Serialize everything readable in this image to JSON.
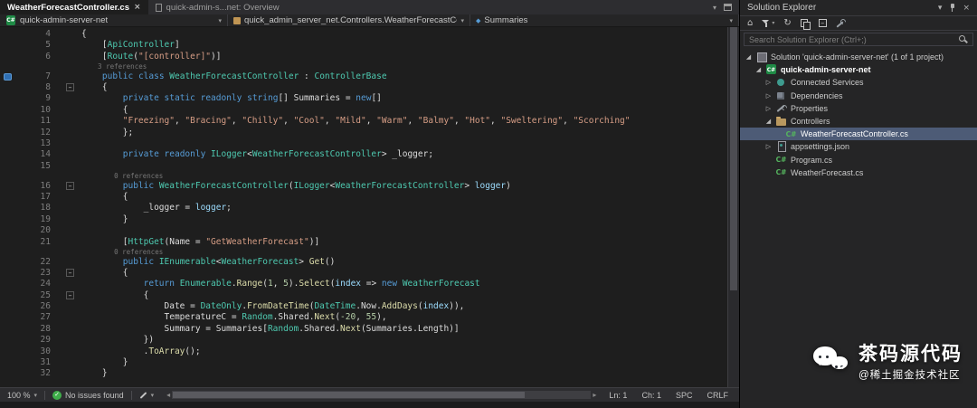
{
  "colors": {
    "accent_blue": "#569cd6",
    "type_teal": "#4ec9b0",
    "string_orange": "#d69d85",
    "status_green": "#3fae4a",
    "selection": "#4d5b76"
  },
  "icons": {
    "close": "×",
    "chevron_down": "▾",
    "check": "✓",
    "home": "⌂",
    "sync": "↻",
    "scroll_left": "◂",
    "scroll_right": "▸",
    "tree_expanded": "◢",
    "tree_collapsed": "▷",
    "csharp": "C#",
    "fold_minus": "–",
    "member_diamond": "◆"
  },
  "window": {
    "tabs": [
      {
        "label": "WeatherForecastController.cs",
        "active": true
      },
      {
        "label": "quick-admin-s...net: Overview",
        "active": false
      }
    ]
  },
  "breadcrumb": {
    "project": "quick-admin-server-net",
    "type_path": "quick_admin_server_net.Controllers.WeatherForecastControlle",
    "member": "Summaries"
  },
  "editor": {
    "lines": [
      {
        "n": "4",
        "seg": [
          [
            "p",
            "{"
          ]
        ]
      },
      {
        "n": "5",
        "seg": [
          [
            "p",
            "    ["
          ],
          [
            "t",
            "ApiController"
          ],
          [
            "p",
            "]"
          ]
        ]
      },
      {
        "n": "6",
        "seg": [
          [
            "p",
            "    ["
          ],
          [
            "t",
            "Route"
          ],
          [
            "p",
            "("
          ],
          [
            "s",
            "\"[controller]\""
          ],
          [
            "p",
            ")]"
          ]
        ]
      },
      {
        "n": "7",
        "lens": "3 references",
        "icon": "bookmark",
        "seg": [
          [
            "p",
            "    "
          ],
          [
            "k",
            "public"
          ],
          [
            "p",
            " "
          ],
          [
            "k",
            "class"
          ],
          [
            "p",
            " "
          ],
          [
            "t",
            "WeatherForecastController"
          ],
          [
            "p",
            " : "
          ],
          [
            "t",
            "ControllerBase"
          ]
        ]
      },
      {
        "n": "8",
        "fold": true,
        "seg": [
          [
            "p",
            "    {"
          ]
        ]
      },
      {
        "n": "9",
        "seg": [
          [
            "p",
            "        "
          ],
          [
            "k",
            "private"
          ],
          [
            "p",
            " "
          ],
          [
            "k",
            "static"
          ],
          [
            "p",
            " "
          ],
          [
            "k",
            "readonly"
          ],
          [
            "p",
            " "
          ],
          [
            "k",
            "string"
          ],
          [
            "p",
            "[] "
          ],
          [
            "p",
            "Summaries"
          ],
          [
            "p",
            " = "
          ],
          [
            "k",
            "new"
          ],
          [
            "p",
            "[]"
          ]
        ]
      },
      {
        "n": "10",
        "seg": [
          [
            "p",
            "        {"
          ]
        ]
      },
      {
        "n": "11",
        "seg": [
          [
            "p",
            "        "
          ],
          [
            "s",
            "\"Freezing\""
          ],
          [
            "p",
            ", "
          ],
          [
            "s",
            "\"Bracing\""
          ],
          [
            "p",
            ", "
          ],
          [
            "s",
            "\"Chilly\""
          ],
          [
            "p",
            ", "
          ],
          [
            "s",
            "\"Cool\""
          ],
          [
            "p",
            ", "
          ],
          [
            "s",
            "\"Mild\""
          ],
          [
            "p",
            ", "
          ],
          [
            "s",
            "\"Warm\""
          ],
          [
            "p",
            ", "
          ],
          [
            "s",
            "\"Balmy\""
          ],
          [
            "p",
            ", "
          ],
          [
            "s",
            "\"Hot\""
          ],
          [
            "p",
            ", "
          ],
          [
            "s",
            "\"Sweltering\""
          ],
          [
            "p",
            ", "
          ],
          [
            "s",
            "\"Scorching\""
          ]
        ]
      },
      {
        "n": "12",
        "seg": [
          [
            "p",
            "        };"
          ]
        ]
      },
      {
        "n": "13",
        "seg": []
      },
      {
        "n": "14",
        "seg": [
          [
            "p",
            "        "
          ],
          [
            "k",
            "private"
          ],
          [
            "p",
            " "
          ],
          [
            "k",
            "readonly"
          ],
          [
            "p",
            " "
          ],
          [
            "t",
            "ILogger"
          ],
          [
            "p",
            "<"
          ],
          [
            "t",
            "WeatherForecastController"
          ],
          [
            "p",
            "> "
          ],
          [
            "p",
            "_logger"
          ],
          [
            "p",
            ";"
          ]
        ]
      },
      {
        "n": "15",
        "seg": []
      },
      {
        "n": "16",
        "lens": "0 references",
        "fold": true,
        "seg": [
          [
            "p",
            "        "
          ],
          [
            "k",
            "public"
          ],
          [
            "p",
            " "
          ],
          [
            "t",
            "WeatherForecastController"
          ],
          [
            "p",
            "("
          ],
          [
            "t",
            "ILogger"
          ],
          [
            "p",
            "<"
          ],
          [
            "t",
            "WeatherForecastController"
          ],
          [
            "p",
            "> "
          ],
          [
            "v",
            "logger"
          ],
          [
            "p",
            ")"
          ]
        ]
      },
      {
        "n": "17",
        "seg": [
          [
            "p",
            "        {"
          ]
        ]
      },
      {
        "n": "18",
        "seg": [
          [
            "p",
            "            _logger = "
          ],
          [
            "v",
            "logger"
          ],
          [
            "p",
            ";"
          ]
        ]
      },
      {
        "n": "19",
        "seg": [
          [
            "p",
            "        }"
          ]
        ]
      },
      {
        "n": "20",
        "seg": []
      },
      {
        "n": "21",
        "seg": [
          [
            "p",
            "        ["
          ],
          [
            "t",
            "HttpGet"
          ],
          [
            "p",
            "("
          ],
          [
            "p",
            "Name"
          ],
          [
            "p",
            " = "
          ],
          [
            "s",
            "\"GetWeatherForecast\""
          ],
          [
            "p",
            ")]"
          ]
        ]
      },
      {
        "n": "22",
        "lens": "0 references",
        "seg": [
          [
            "p",
            "        "
          ],
          [
            "k",
            "public"
          ],
          [
            "p",
            " "
          ],
          [
            "t",
            "IEnumerable"
          ],
          [
            "p",
            "<"
          ],
          [
            "t",
            "WeatherForecast"
          ],
          [
            "p",
            "> "
          ],
          [
            "m",
            "Get"
          ],
          [
            "p",
            "()"
          ]
        ]
      },
      {
        "n": "23",
        "fold": true,
        "seg": [
          [
            "p",
            "        {"
          ]
        ]
      },
      {
        "n": "24",
        "seg": [
          [
            "p",
            "            "
          ],
          [
            "k",
            "return"
          ],
          [
            "p",
            " "
          ],
          [
            "t",
            "Enumerable"
          ],
          [
            "p",
            "."
          ],
          [
            "m",
            "Range"
          ],
          [
            "p",
            "("
          ],
          [
            "num",
            "1"
          ],
          [
            "p",
            ", "
          ],
          [
            "num",
            "5"
          ],
          [
            "p",
            ")."
          ],
          [
            "m",
            "Select"
          ],
          [
            "p",
            "("
          ],
          [
            "v",
            "index"
          ],
          [
            "p",
            " => "
          ],
          [
            "k",
            "new"
          ],
          [
            "p",
            " "
          ],
          [
            "t",
            "WeatherForecast"
          ]
        ]
      },
      {
        "n": "25",
        "fold": true,
        "seg": [
          [
            "p",
            "            {"
          ]
        ]
      },
      {
        "n": "26",
        "seg": [
          [
            "p",
            "                "
          ],
          [
            "p",
            "Date"
          ],
          [
            "p",
            " = "
          ],
          [
            "t",
            "DateOnly"
          ],
          [
            "p",
            "."
          ],
          [
            "m",
            "FromDateTime"
          ],
          [
            "p",
            "("
          ],
          [
            "t",
            "DateTime"
          ],
          [
            "p",
            ".Now."
          ],
          [
            "m",
            "AddDays"
          ],
          [
            "p",
            "("
          ],
          [
            "v",
            "index"
          ],
          [
            "p",
            ")),"
          ]
        ]
      },
      {
        "n": "27",
        "seg": [
          [
            "p",
            "                "
          ],
          [
            "p",
            "TemperatureC"
          ],
          [
            "p",
            " = "
          ],
          [
            "t",
            "Random"
          ],
          [
            "p",
            ".Shared."
          ],
          [
            "m",
            "Next"
          ],
          [
            "p",
            "("
          ],
          [
            "num",
            "-20"
          ],
          [
            "p",
            ", "
          ],
          [
            "num",
            "55"
          ],
          [
            "p",
            "),"
          ]
        ]
      },
      {
        "n": "28",
        "seg": [
          [
            "p",
            "                "
          ],
          [
            "p",
            "Summary"
          ],
          [
            "p",
            " = "
          ],
          [
            "p",
            "Summaries"
          ],
          [
            "p",
            "["
          ],
          [
            "t",
            "Random"
          ],
          [
            "p",
            ".Shared."
          ],
          [
            "m",
            "Next"
          ],
          [
            "p",
            "("
          ],
          [
            "p",
            "Summaries.Length"
          ],
          [
            "p",
            ")]"
          ]
        ]
      },
      {
        "n": "29",
        "seg": [
          [
            "p",
            "            })"
          ]
        ]
      },
      {
        "n": "30",
        "seg": [
          [
            "p",
            "            ."
          ],
          [
            "m",
            "ToArray"
          ],
          [
            "p",
            "();"
          ]
        ]
      },
      {
        "n": "31",
        "seg": [
          [
            "p",
            "        }"
          ]
        ]
      },
      {
        "n": "32",
        "seg": [
          [
            "p",
            "    }"
          ]
        ]
      }
    ]
  },
  "status_bar": {
    "zoom": "100 %",
    "issues": "No issues found",
    "ln": "Ln: 1",
    "ch": "Ch: 1",
    "spaces": "SPC",
    "line_ending": "CRLF"
  },
  "solution_explorer": {
    "title": "Solution Explorer",
    "search_placeholder": "Search Solution Explorer (Ctrl+;)",
    "items": [
      {
        "label": "Solution 'quick-admin-server-net' (1 of 1 project)",
        "indent": 0,
        "icon": "solution",
        "expand": "open"
      },
      {
        "label": "quick-admin-server-net",
        "indent": 1,
        "icon": "csproj",
        "expand": "open",
        "bold": true
      },
      {
        "label": "Connected Services",
        "indent": 2,
        "icon": "connected-services",
        "expand": "closed"
      },
      {
        "label": "Dependencies",
        "indent": 2,
        "icon": "dependencies",
        "expand": "closed"
      },
      {
        "label": "Properties",
        "indent": 2,
        "icon": "properties",
        "expand": "closed"
      },
      {
        "label": "Controllers",
        "indent": 2,
        "icon": "folder",
        "expand": "open"
      },
      {
        "label": "WeatherForecastController.cs",
        "indent": 3,
        "icon": "cs",
        "expand": "none",
        "selected": true
      },
      {
        "label": "appsettings.json",
        "indent": 2,
        "icon": "json",
        "expand": "closed"
      },
      {
        "label": "Program.cs",
        "indent": 2,
        "icon": "cs",
        "expand": "none"
      },
      {
        "label": "WeatherForecast.cs",
        "indent": 2,
        "icon": "cs",
        "expand": "none"
      }
    ]
  },
  "watermark": {
    "title": "茶码源代码",
    "subtitle": "@稀土掘金技术社区"
  }
}
